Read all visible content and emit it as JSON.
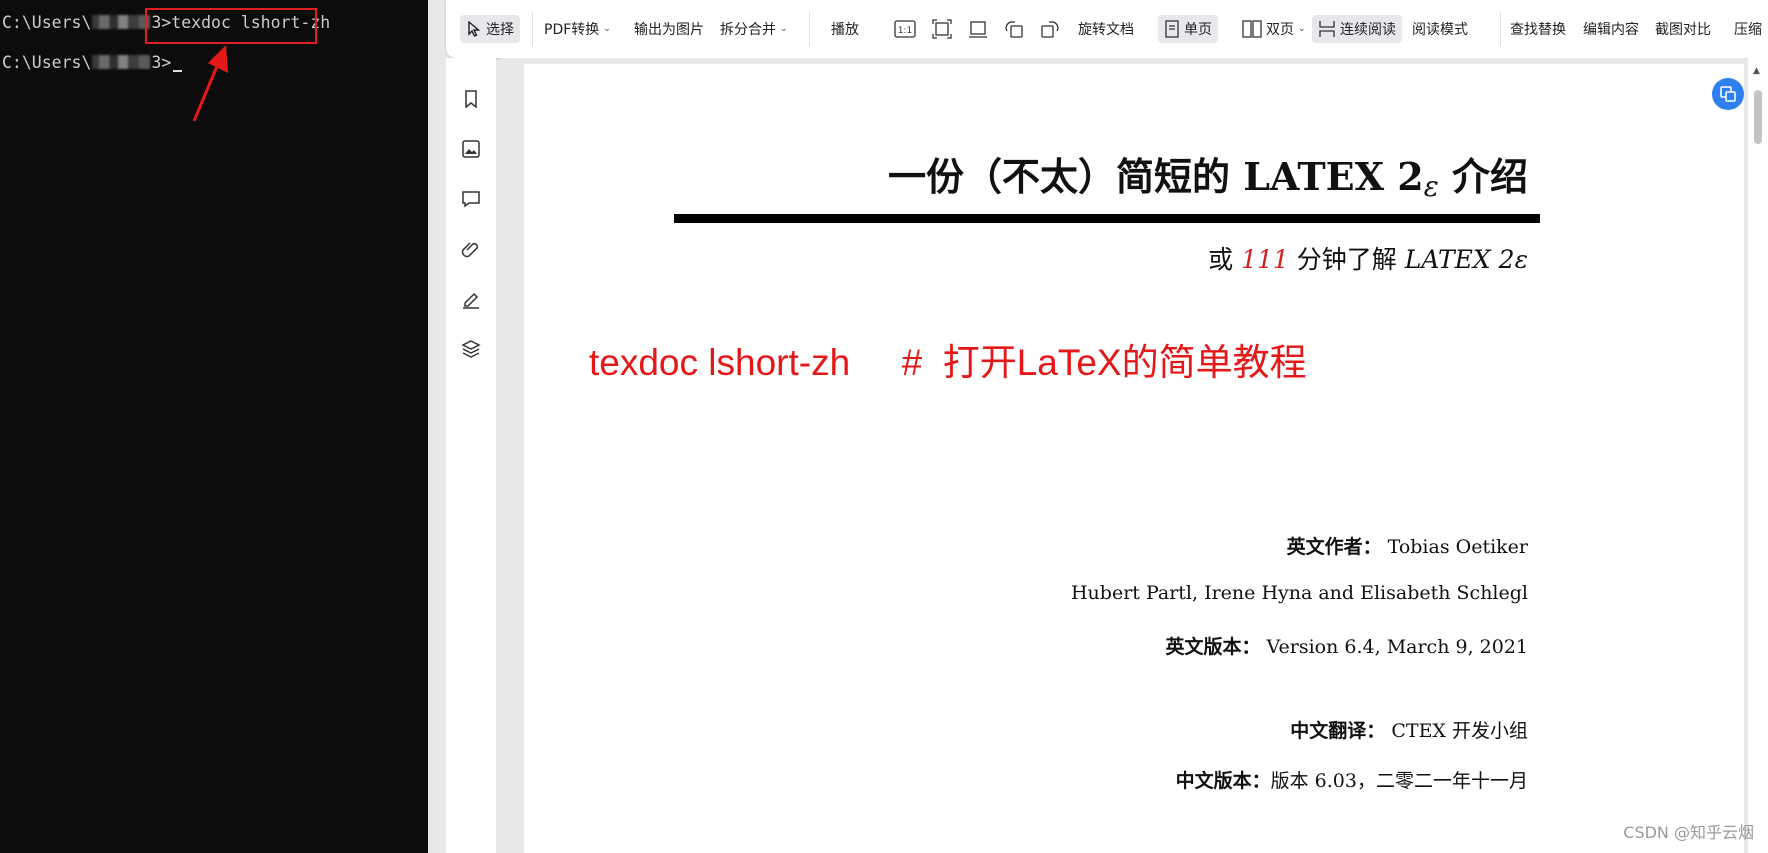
{
  "terminal": {
    "prompt_prefix": "C:\\Users\\",
    "prompt_suffix_1": "3>",
    "command": "texdoc lshort-zh",
    "prompt_suffix_2": "3>"
  },
  "toolbar": {
    "items": [
      {
        "label": "选择",
        "icon": "cursor-icon"
      },
      {
        "label": "PDF转换",
        "icon": "convert-icon"
      },
      {
        "label": "输出为图片",
        "icon": "image-export-icon"
      },
      {
        "label": "拆分合并",
        "icon": "split-merge-icon"
      },
      {
        "label": "播放",
        "icon": "play-icon"
      },
      {
        "label": "旋转文档",
        "icon": "rotate-icon"
      },
      {
        "label": "单页",
        "icon": "single-page-icon"
      },
      {
        "label": "双页",
        "icon": "double-page-icon"
      },
      {
        "label": "连续阅读",
        "icon": "continuous-read-icon"
      },
      {
        "label": "阅读模式",
        "icon": "read-mode-icon"
      },
      {
        "label": "查找替换",
        "icon": "find-replace-icon"
      },
      {
        "label": "编辑内容",
        "icon": "edit-content-icon"
      },
      {
        "label": "截图对比",
        "icon": "screenshot-compare-icon"
      },
      {
        "label": "压缩",
        "icon": "compress-icon"
      }
    ]
  },
  "sidebar": {
    "icons": [
      "bookmark-icon",
      "image-icon",
      "comment-icon",
      "attachment-icon",
      "signature-icon",
      "layers-icon"
    ]
  },
  "document": {
    "title_main": "一份（不太）简短的 LATEX 2",
    "title_epsilon": "ε",
    "title_tail": " 介绍",
    "subtitle_pre": "或 ",
    "subtitle_num": "111",
    "subtitle_mid": " 分钟了解 ",
    "subtitle_latex": "LATEX 2ε",
    "overlay_note": "texdoc lshort-zh     #  打开LaTeX的简单教程",
    "author_label": "英文作者：",
    "author_value": " Tobias Oetiker",
    "coauthors": "Hubert Partl, Irene Hyna and Elisabeth Schlegl",
    "version_label": "英文版本：",
    "version_value": " Version 6.4, March 9, 2021",
    "translator_label": "中文翻译：",
    "translator_value": " CTEX 开发小组",
    "cn_version_label": "中文版本：",
    "cn_version_value": "版本 6.03，二零二一年十一月"
  },
  "watermark": "CSDN @知乎云烟",
  "colors": {
    "annotation_red": "#e41818",
    "accent_blue": "#2f80ed",
    "terminal_bg": "#0c0c0c"
  }
}
